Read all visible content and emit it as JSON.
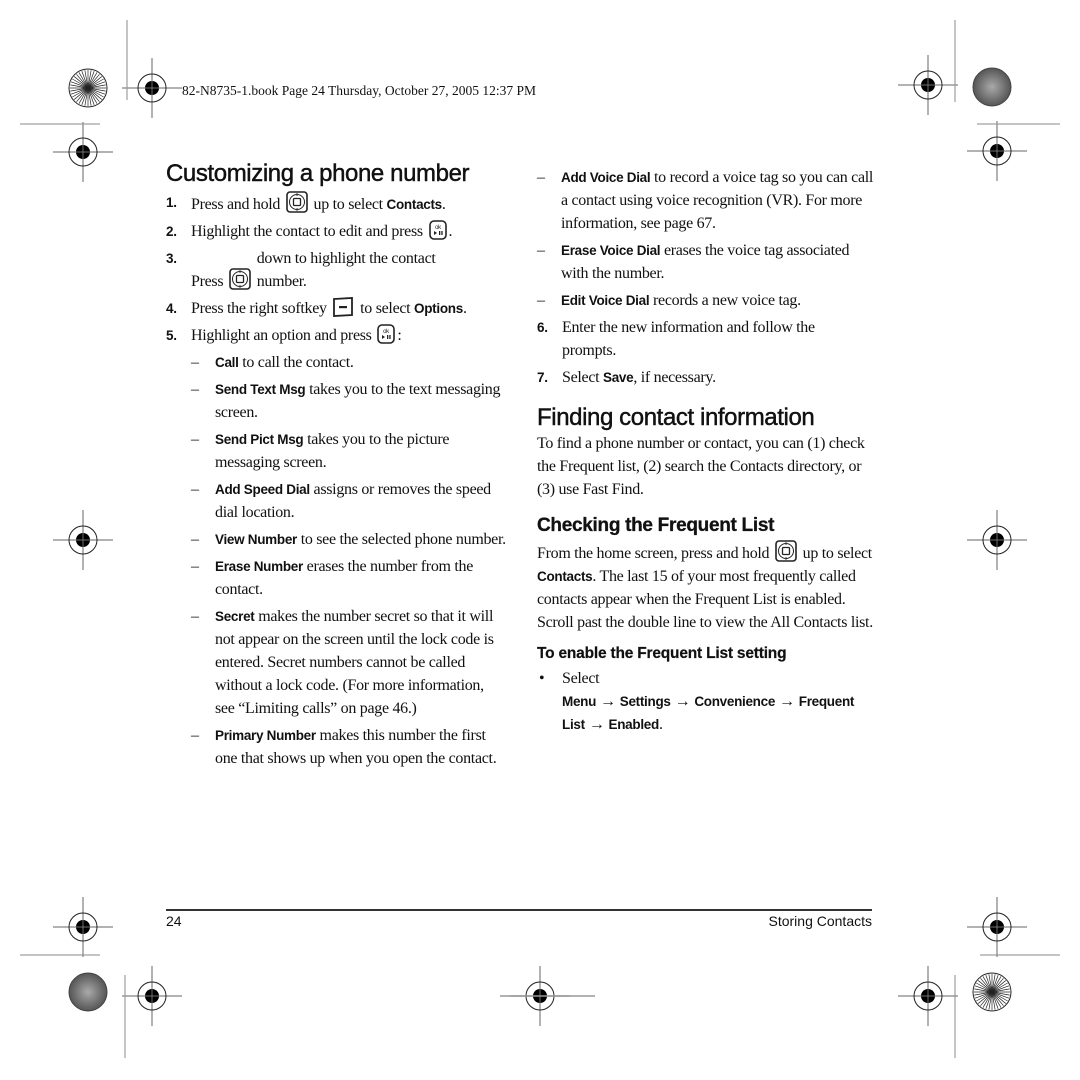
{
  "slug_line": "82-N8735-1.book  Page 24  Thursday, October 27, 2005  12:37 PM",
  "left_column": {
    "title": "Customizing a phone number",
    "steps": [
      {
        "num": "1.",
        "pre": "Press and hold",
        "icon": "navigation-key-icon",
        "post": "up to select",
        "kw": "Contacts",
        "end": "."
      },
      {
        "num": "2.",
        "pre": "Highlight the contact to edit and press",
        "icon": "ok-key-icon",
        "end": "."
      },
      {
        "num": "3.",
        "pre": "Press",
        "icon": "navigation-key-icon",
        "post": "down to highlight the contact number."
      },
      {
        "num": "4.",
        "pre": "Press the right softkey",
        "icon": "right-softkey-icon",
        "post": "to select",
        "kw": "Options",
        "end": "."
      },
      {
        "num": "5.",
        "pre": "Highlight an option and press",
        "icon": "ok-key-icon",
        "end": ":"
      }
    ],
    "options": [
      {
        "kw": "Call",
        "text": "to call the contact."
      },
      {
        "kw": "Send Text Msg",
        "text": "takes you to the text messaging screen."
      },
      {
        "kw": "Send Pict Msg",
        "text": "takes you to the picture messaging screen."
      },
      {
        "kw": "Add Speed Dial",
        "text": "assigns or removes the speed dial location."
      },
      {
        "kw": "View Number",
        "text": "to see the selected phone number."
      },
      {
        "kw": "Erase Number",
        "text": "erases the number from the contact."
      },
      {
        "kw": "Secret",
        "text": "makes the number secret so that it will not appear on the screen until the lock code is entered. Secret numbers cannot be called without a lock code. (For more information, see “Limiting calls” on page 46.)"
      },
      {
        "kw": "Primary Number",
        "text": "makes this number the first one that shows up when you open the contact."
      }
    ]
  },
  "right_column": {
    "options": [
      {
        "kw": "Add Voice Dial",
        "text": "to record a voice tag so you can call a contact using voice recognition (VR). For more information, see page 67."
      },
      {
        "kw": "Erase Voice Dial",
        "text": "erases the voice tag associated with the number."
      },
      {
        "kw": "Edit Voice Dial",
        "text": "records a new voice tag."
      }
    ],
    "steps": [
      {
        "num": "6.",
        "text": "Enter the new information and follow the prompts."
      },
      {
        "num": "7.",
        "pre": "Select",
        "kw": "Save",
        "post": ", if necessary."
      }
    ],
    "finding": {
      "title": "Finding contact information",
      "text": "To find a phone number or contact, you can (1) check the Frequent list, (2) search the Contacts directory, or (3) use Fast Find."
    },
    "frequent": {
      "title": "Checking the Frequent List",
      "pre": "From the home screen, press and hold",
      "icon": "navigation-key-icon",
      "post": "up to select",
      "kw": "Contacts",
      "rest": ". The last 15 of your most frequently called contacts appear when the Frequent List is enabled. Scroll past the double line to view the All Contacts list."
    },
    "enable": {
      "title": "To enable the Frequent List setting",
      "bullet": "•",
      "pre": "Select",
      "path": [
        "Menu",
        "Settings",
        "Convenience",
        "Frequent List",
        "Enabled"
      ],
      "arrow": "→",
      "end": "."
    }
  },
  "footer": {
    "page_number": "24",
    "section": "Storing Contacts"
  },
  "dash_char": "–"
}
